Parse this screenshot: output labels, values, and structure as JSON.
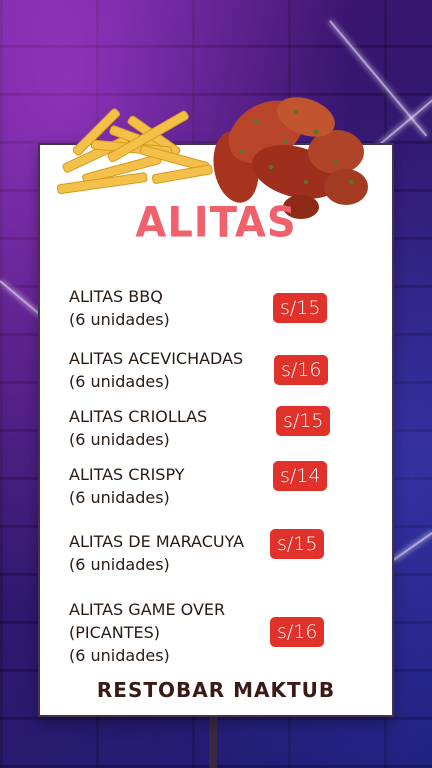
{
  "menu": {
    "title": "ALITAS",
    "items": [
      {
        "name": "ALITAS BBQ",
        "detail": "(6 unidades)",
        "price": "s/15"
      },
      {
        "name": "ALITAS ACEVICHADAS",
        "detail": "(6 unidades)",
        "price": "s/16"
      },
      {
        "name": "ALITAS CRIOLLAS",
        "detail": "(6 unidades)",
        "price": "s/15"
      },
      {
        "name": "ALITAS CRISPY",
        "detail": "(6 unidades)",
        "price": "s/14"
      },
      {
        "name": "ALITAS DE MARACUYA",
        "detail": "(6 unidades)",
        "price": "s/15"
      },
      {
        "name": "ALITAS GAME OVER",
        "name2": "(PICANTES)",
        "detail": "(6 unidades)",
        "price": "s/16"
      }
    ],
    "footer": "RESTOBAR MAKTUB"
  },
  "colors": {
    "title": "#f0616c",
    "price_badge": "#e0322a",
    "background": "#3b1670"
  }
}
